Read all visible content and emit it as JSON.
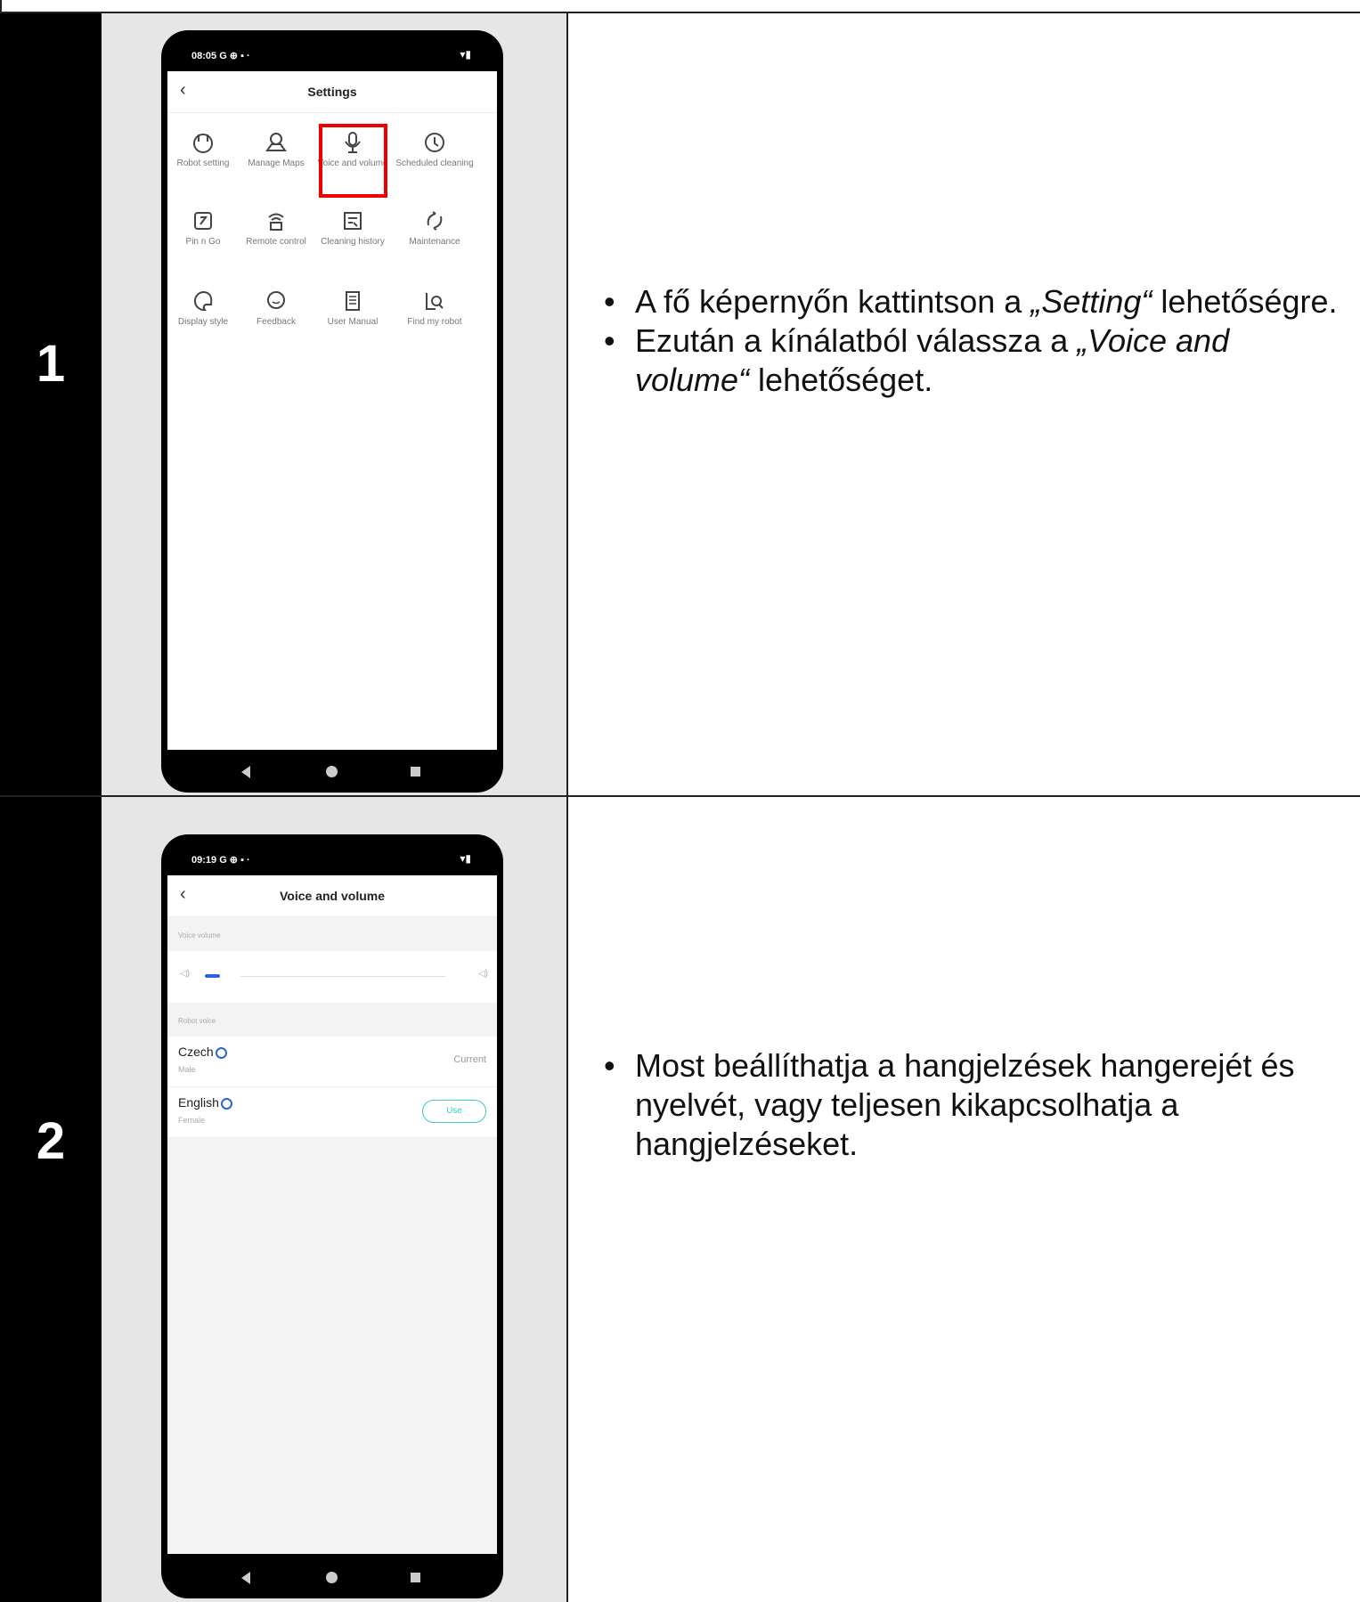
{
  "steps": [
    {
      "number": "1",
      "bullets": [
        {
          "pre": "A fő képernyőn kattintson a ",
          "em": "„Setting“",
          "post": " lehetőségre."
        },
        {
          "pre": "Ezután a kínálatból válassza a ",
          "em": "„Voice and volume“",
          "post": " lehetőséget."
        }
      ],
      "phone": {
        "time": "08:05",
        "title": "Settings",
        "grid": [
          {
            "label": "Robot setting",
            "icon": "robot-icon"
          },
          {
            "label": "Manage Maps",
            "icon": "map-icon"
          },
          {
            "label": "Voice and volume",
            "icon": "microphone-icon"
          },
          {
            "label": "Scheduled cleaning",
            "icon": "clock-icon"
          },
          {
            "label": "Pin n Go",
            "icon": "pin-icon"
          },
          {
            "label": "Remote control",
            "icon": "remote-icon"
          },
          {
            "label": "Cleaning history",
            "icon": "history-icon"
          },
          {
            "label": "Maintenance",
            "icon": "maintenance-icon"
          },
          {
            "label": "Display style",
            "icon": "palette-icon"
          },
          {
            "label": "Feedback",
            "icon": "chat-icon"
          },
          {
            "label": "User Manual",
            "icon": "manual-icon"
          },
          {
            "label": "Find my robot",
            "icon": "find-icon"
          }
        ]
      }
    },
    {
      "number": "2",
      "bullets": [
        {
          "pre": "Most beállíthatja a hangjelzések hangerejét és nyelvét, vagy teljesen kikapcsolhatja a hangjelzéseket.",
          "em": "",
          "post": ""
        }
      ],
      "phone": {
        "time": "09:19",
        "title": "Voice and volume",
        "volume_section": "Voice volume",
        "voice_section": "Robot voice",
        "volume_level": 0.05,
        "languages": [
          {
            "name": "Czech",
            "sub": "Male",
            "status": "Current"
          },
          {
            "name": "English",
            "sub": "Female",
            "action": "Use"
          }
        ]
      }
    }
  ]
}
